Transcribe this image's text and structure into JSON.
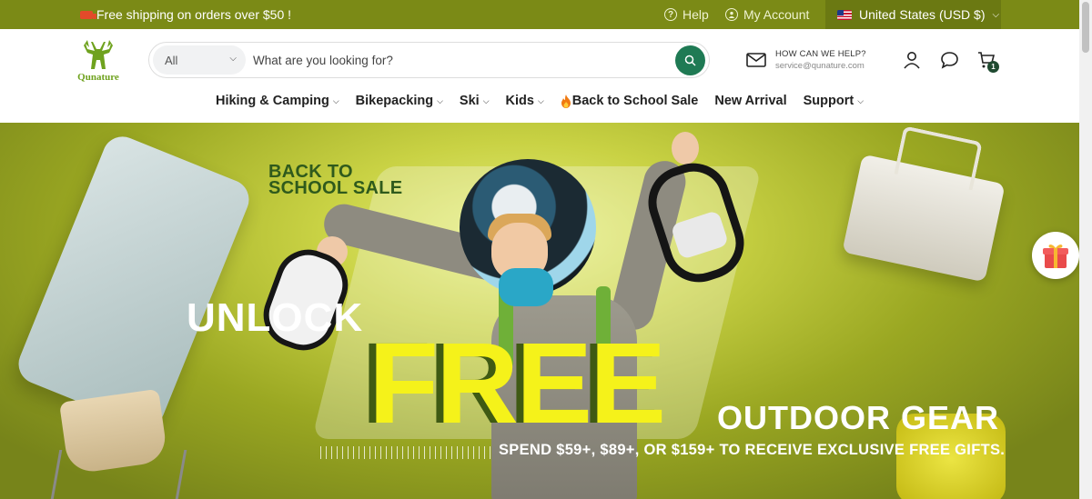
{
  "topbar": {
    "shipping_text": "Free shipping on orders over $50 !",
    "help_label": "Help",
    "account_label": "My Account",
    "region_label": "United States (USD $)"
  },
  "header": {
    "logo_text": "Qunature",
    "search": {
      "category": "All",
      "placeholder": "What are you looking for?"
    },
    "contact": {
      "title": "HOW CAN WE HELP?",
      "email": "service@qunature.com"
    },
    "cart_count": "1"
  },
  "nav": {
    "items": [
      {
        "label": "Hiking & Camping",
        "has_dropdown": true
      },
      {
        "label": "Bikepacking",
        "has_dropdown": true
      },
      {
        "label": "Ski",
        "has_dropdown": true
      },
      {
        "label": "Kids",
        "has_dropdown": true
      },
      {
        "label": "Back to School Sale",
        "has_dropdown": false,
        "icon": "fire-icon"
      },
      {
        "label": "New Arrival",
        "has_dropdown": false
      },
      {
        "label": "Support",
        "has_dropdown": true
      }
    ]
  },
  "hero": {
    "tag_line1": "BACK TO",
    "tag_line2": "SCHOOL SALE",
    "unlock": "UNLOCK",
    "free": "FREE",
    "outdoor_gear": "OUTDOOR GEAR",
    "spend_text": "SPEND $59+, $89+, OR $159+ TO RECEIVE EXCLUSIVE FREE GIFTS."
  },
  "colors": {
    "topbar_bg": "#7b8a16",
    "region_bg": "#6b7912",
    "search_button": "#1f7a54",
    "free_yellow": "#f5f21a"
  }
}
